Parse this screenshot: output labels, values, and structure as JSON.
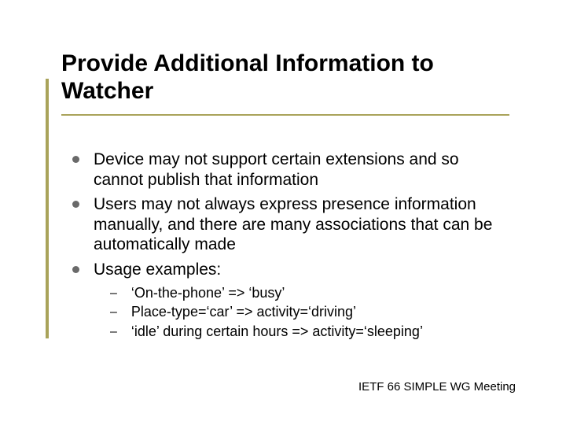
{
  "title": "Provide Additional Information to Watcher",
  "bullets": [
    {
      "text": "Device may not support certain extensions and so cannot publish that information"
    },
    {
      "text": "Users may not always express presence information manually, and there are many associations that can be automatically made"
    },
    {
      "text": "Usage examples:"
    }
  ],
  "sub_bullets": [
    {
      "text": "‘On-the-phone’ => ‘busy’"
    },
    {
      "text": "Place-type=‘car’ => activity=‘driving’"
    },
    {
      "text": "‘idle’ during certain hours => activity=‘sleeping’"
    }
  ],
  "footer": "IETF 66 SIMPLE WG Meeting"
}
